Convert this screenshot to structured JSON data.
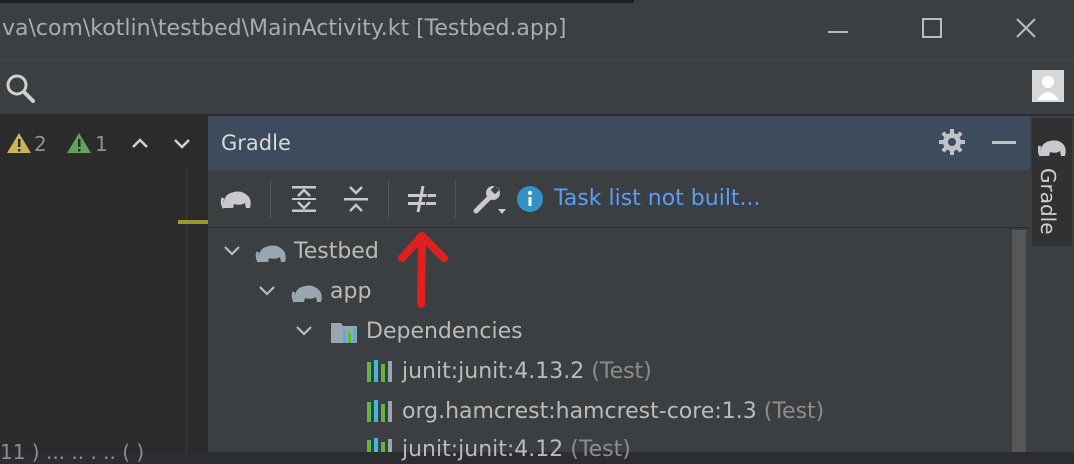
{
  "window": {
    "title": "va\\com\\kotlin\\testbed\\MainActivity.kt [Testbed.app]"
  },
  "editor": {
    "warning_count": "2",
    "weak_warning_count": "1",
    "bottom_fragment": "11 )    ... .. . .. ( )"
  },
  "gradle": {
    "title": "Gradle",
    "status_text": "Task list not built...",
    "tree": {
      "root": "Testbed",
      "module": "app",
      "dependencies": "Dependencies",
      "items": [
        {
          "name": "junit:junit:4.13.2",
          "scope": "(Test)"
        },
        {
          "name": "org.hamcrest:hamcrest-core:1.3",
          "scope": "(Test)"
        },
        {
          "name": "junit:junit:4.12",
          "scope": "(Test)"
        }
      ]
    }
  },
  "tool_strip": {
    "label": "Gradle"
  },
  "colors": {
    "accent_link": "#589df6",
    "header_bg": "#3d4b5c",
    "annotation_arrow": "#e02020",
    "warning_yellow": "#c9b45a",
    "warning_green": "#5fa35f"
  },
  "icons": {
    "search": "search-icon",
    "avatar": "user-avatar-icon",
    "gradle": "gradle-elephant-icon",
    "settings": "gear-icon"
  }
}
